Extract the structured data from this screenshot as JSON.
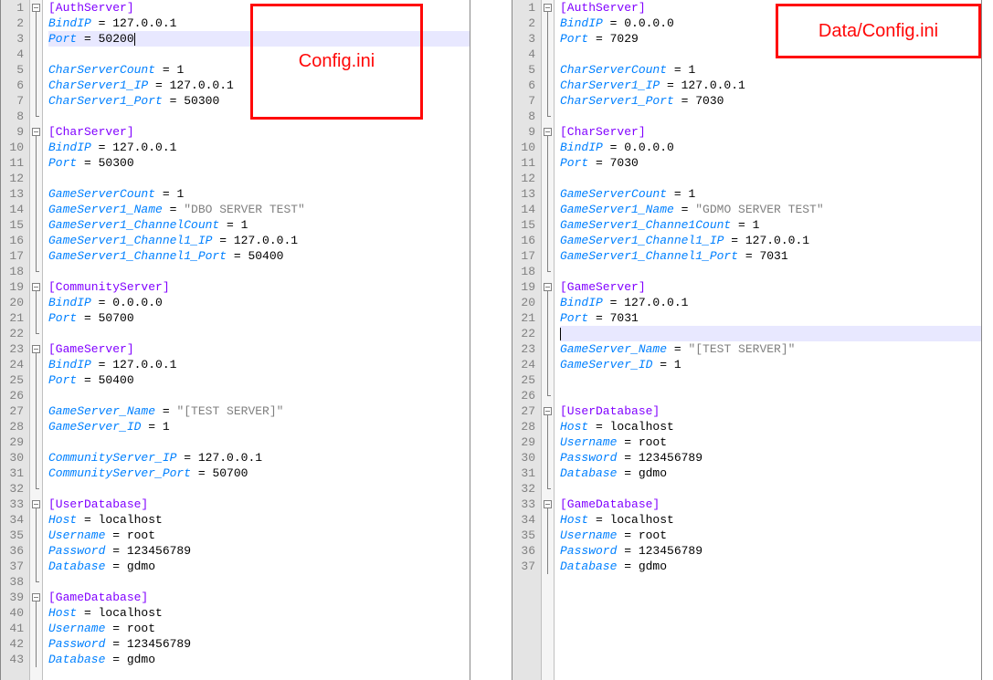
{
  "left": {
    "filename_annotation": "Config.ini",
    "highlighted_lines": [
      3
    ],
    "cursor_line": 3,
    "lines": [
      {
        "n": 1,
        "fold": "open",
        "type": "section",
        "text": "[AuthServer]"
      },
      {
        "n": 2,
        "fold": "v",
        "type": "kv",
        "key": "BindIP",
        "val": "127.0.0.1"
      },
      {
        "n": 3,
        "fold": "v",
        "type": "kv",
        "key": "Port",
        "val": "50200"
      },
      {
        "n": 4,
        "fold": "v",
        "type": "blank"
      },
      {
        "n": 5,
        "fold": "v",
        "type": "kv",
        "key": "CharServerCount",
        "val": "1"
      },
      {
        "n": 6,
        "fold": "v",
        "type": "kv",
        "key": "CharServer1_IP",
        "val": "127.0.0.1"
      },
      {
        "n": 7,
        "fold": "v",
        "type": "kv",
        "key": "CharServer1_Port",
        "val": "50300"
      },
      {
        "n": 8,
        "fold": "end",
        "type": "blank"
      },
      {
        "n": 9,
        "fold": "open",
        "type": "section",
        "text": "[CharServer]"
      },
      {
        "n": 10,
        "fold": "v",
        "type": "kv",
        "key": "BindIP",
        "val": "127.0.0.1"
      },
      {
        "n": 11,
        "fold": "v",
        "type": "kv",
        "key": "Port",
        "val": "50300"
      },
      {
        "n": 12,
        "fold": "v",
        "type": "blank"
      },
      {
        "n": 13,
        "fold": "v",
        "type": "kv",
        "key": "GameServerCount",
        "val": "1"
      },
      {
        "n": 14,
        "fold": "v",
        "type": "kv",
        "key": "GameServer1_Name",
        "val": "\"DBO SERVER TEST\"",
        "is_str": true
      },
      {
        "n": 15,
        "fold": "v",
        "type": "kv",
        "key": "GameServer1_ChannelCount",
        "val": "1"
      },
      {
        "n": 16,
        "fold": "v",
        "type": "kv",
        "key": "GameServer1_Channel1_IP",
        "val": "127.0.0.1"
      },
      {
        "n": 17,
        "fold": "v",
        "type": "kv",
        "key": "GameServer1_Channel1_Port",
        "val": "50400"
      },
      {
        "n": 18,
        "fold": "end",
        "type": "blank"
      },
      {
        "n": 19,
        "fold": "open",
        "type": "section",
        "text": "[CommunityServer]"
      },
      {
        "n": 20,
        "fold": "v",
        "type": "kv",
        "key": "BindIP",
        "val": "0.0.0.0"
      },
      {
        "n": 21,
        "fold": "v",
        "type": "kv",
        "key": "Port",
        "val": "50700"
      },
      {
        "n": 22,
        "fold": "end",
        "type": "blank"
      },
      {
        "n": 23,
        "fold": "open",
        "type": "section",
        "text": "[GameServer]"
      },
      {
        "n": 24,
        "fold": "v",
        "type": "kv",
        "key": "BindIP",
        "val": "127.0.0.1"
      },
      {
        "n": 25,
        "fold": "v",
        "type": "kv",
        "key": "Port",
        "val": "50400"
      },
      {
        "n": 26,
        "fold": "v",
        "type": "blank"
      },
      {
        "n": 27,
        "fold": "v",
        "type": "kv",
        "key": "GameServer_Name",
        "val": "\"[TEST SERVER]\"",
        "is_str": true
      },
      {
        "n": 28,
        "fold": "v",
        "type": "kv",
        "key": "GameServer_ID",
        "val": "1"
      },
      {
        "n": 29,
        "fold": "v",
        "type": "blank"
      },
      {
        "n": 30,
        "fold": "v",
        "type": "kv",
        "key": "CommunityServer_IP",
        "val": "127.0.0.1"
      },
      {
        "n": 31,
        "fold": "v",
        "type": "kv",
        "key": "CommunityServer_Port",
        "val": "50700"
      },
      {
        "n": 32,
        "fold": "end",
        "type": "blank"
      },
      {
        "n": 33,
        "fold": "open",
        "type": "section",
        "text": "[UserDatabase]"
      },
      {
        "n": 34,
        "fold": "v",
        "type": "kv",
        "key": "Host",
        "val": "localhost"
      },
      {
        "n": 35,
        "fold": "v",
        "type": "kv",
        "key": "Username",
        "val": "root"
      },
      {
        "n": 36,
        "fold": "v",
        "type": "kv",
        "key": "Password",
        "val": "123456789"
      },
      {
        "n": 37,
        "fold": "v",
        "type": "kv",
        "key": "Database",
        "val": "gdmo"
      },
      {
        "n": 38,
        "fold": "end",
        "type": "blank"
      },
      {
        "n": 39,
        "fold": "open",
        "type": "section",
        "text": "[GameDatabase]"
      },
      {
        "n": 40,
        "fold": "v",
        "type": "kv",
        "key": "Host",
        "val": "localhost"
      },
      {
        "n": 41,
        "fold": "v",
        "type": "kv",
        "key": "Username",
        "val": "root"
      },
      {
        "n": 42,
        "fold": "v",
        "type": "kv",
        "key": "Password",
        "val": "123456789"
      },
      {
        "n": 43,
        "fold": "v",
        "type": "kv",
        "key": "Database",
        "val": "gdmo"
      }
    ]
  },
  "right": {
    "filename_annotation": "Data/Config.ini",
    "highlighted_lines": [
      22
    ],
    "cursor_line": 22,
    "lines": [
      {
        "n": 1,
        "fold": "open",
        "type": "section",
        "text": "[AuthServer]"
      },
      {
        "n": 2,
        "fold": "v",
        "type": "kv",
        "key": "BindIP",
        "val": "0.0.0.0"
      },
      {
        "n": 3,
        "fold": "v",
        "type": "kv",
        "key": "Port",
        "val": "7029"
      },
      {
        "n": 4,
        "fold": "v",
        "type": "blank"
      },
      {
        "n": 5,
        "fold": "v",
        "type": "kv",
        "key": "CharServerCount",
        "val": "1"
      },
      {
        "n": 6,
        "fold": "v",
        "type": "kv",
        "key": "CharServer1_IP",
        "val": "127.0.0.1"
      },
      {
        "n": 7,
        "fold": "v",
        "type": "kv",
        "key": "CharServer1_Port",
        "val": "7030"
      },
      {
        "n": 8,
        "fold": "end",
        "type": "blank"
      },
      {
        "n": 9,
        "fold": "open",
        "type": "section",
        "text": "[CharServer]"
      },
      {
        "n": 10,
        "fold": "v",
        "type": "kv",
        "key": "BindIP",
        "val": "0.0.0.0"
      },
      {
        "n": 11,
        "fold": "v",
        "type": "kv",
        "key": "Port",
        "val": "7030"
      },
      {
        "n": 12,
        "fold": "v",
        "type": "blank"
      },
      {
        "n": 13,
        "fold": "v",
        "type": "kv",
        "key": "GameServerCount",
        "val": "1"
      },
      {
        "n": 14,
        "fold": "v",
        "type": "kv",
        "key": "GameServer1_Name",
        "val": "\"GDMO SERVER TEST\"",
        "is_str": true
      },
      {
        "n": 15,
        "fold": "v",
        "type": "kv",
        "key": "GameServer1_Channe1Count",
        "val": "1"
      },
      {
        "n": 16,
        "fold": "v",
        "type": "kv",
        "key": "GameServer1_Channel1_IP",
        "val": "127.0.0.1"
      },
      {
        "n": 17,
        "fold": "v",
        "type": "kv",
        "key": "GameServer1_Channel1_Port",
        "val": "7031"
      },
      {
        "n": 18,
        "fold": "end",
        "type": "blank"
      },
      {
        "n": 19,
        "fold": "open",
        "type": "section",
        "text": "[GameServer]"
      },
      {
        "n": 20,
        "fold": "v",
        "type": "kv",
        "key": "BindIP",
        "val": "127.0.0.1"
      },
      {
        "n": 21,
        "fold": "v",
        "type": "kv",
        "key": "Port",
        "val": "7031"
      },
      {
        "n": 22,
        "fold": "v",
        "type": "blank"
      },
      {
        "n": 23,
        "fold": "v",
        "type": "kv",
        "key": "GameServer_Name",
        "val": "\"[TEST SERVER]\"",
        "is_str": true
      },
      {
        "n": 24,
        "fold": "v",
        "type": "kv",
        "key": "GameServer_ID",
        "val": "1"
      },
      {
        "n": 25,
        "fold": "v",
        "type": "blank"
      },
      {
        "n": 26,
        "fold": "end",
        "type": "blank"
      },
      {
        "n": 27,
        "fold": "open",
        "type": "section",
        "text": "[UserDatabase]"
      },
      {
        "n": 28,
        "fold": "v",
        "type": "kv",
        "key": "Host",
        "val": "localhost"
      },
      {
        "n": 29,
        "fold": "v",
        "type": "kv",
        "key": "Username",
        "val": "root"
      },
      {
        "n": 30,
        "fold": "v",
        "type": "kv",
        "key": "Password",
        "val": "123456789"
      },
      {
        "n": 31,
        "fold": "v",
        "type": "kv",
        "key": "Database",
        "val": "gdmo"
      },
      {
        "n": 32,
        "fold": "end",
        "type": "blank"
      },
      {
        "n": 33,
        "fold": "open",
        "type": "section",
        "text": "[GameDatabase]"
      },
      {
        "n": 34,
        "fold": "v",
        "type": "kv",
        "key": "Host",
        "val": "localhost"
      },
      {
        "n": 35,
        "fold": "v",
        "type": "kv",
        "key": "Username",
        "val": "root"
      },
      {
        "n": 36,
        "fold": "v",
        "type": "kv",
        "key": "Password",
        "val": "123456789"
      },
      {
        "n": 37,
        "fold": "v",
        "type": "kv",
        "key": "Database",
        "val": "gdmo"
      }
    ]
  }
}
